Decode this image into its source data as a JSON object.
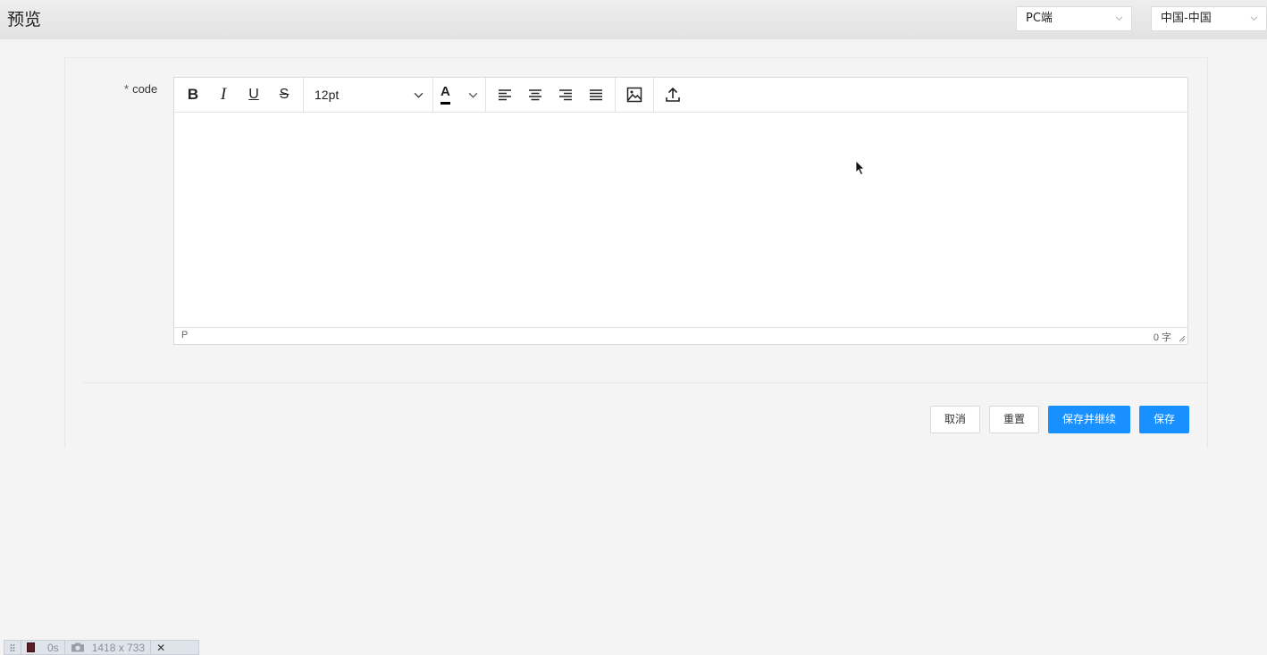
{
  "header": {
    "title": "预览",
    "platform_select": {
      "value": "PC端"
    },
    "locale_select": {
      "value": "中国-中国"
    }
  },
  "form": {
    "field": {
      "required_mark": "*",
      "label": "code"
    },
    "editor": {
      "toolbar": {
        "bold": "B",
        "italic": "I",
        "underline": "U",
        "strikethrough": "S",
        "font_size": "12pt",
        "font_color_letter": "A",
        "font_color": "#000000"
      },
      "content": "",
      "status_path": "P",
      "word_count": "0 字"
    },
    "buttons": {
      "cancel": "取消",
      "reset": "重置",
      "save_continue": "保存并继续",
      "save": "保存"
    }
  },
  "recorder": {
    "time": "0s",
    "size": "1418 x 733",
    "close": "✕"
  },
  "colors": {
    "primary": "#1890ff",
    "header_bg": "#e6e6e6",
    "page_bg": "#f4f4f4"
  }
}
